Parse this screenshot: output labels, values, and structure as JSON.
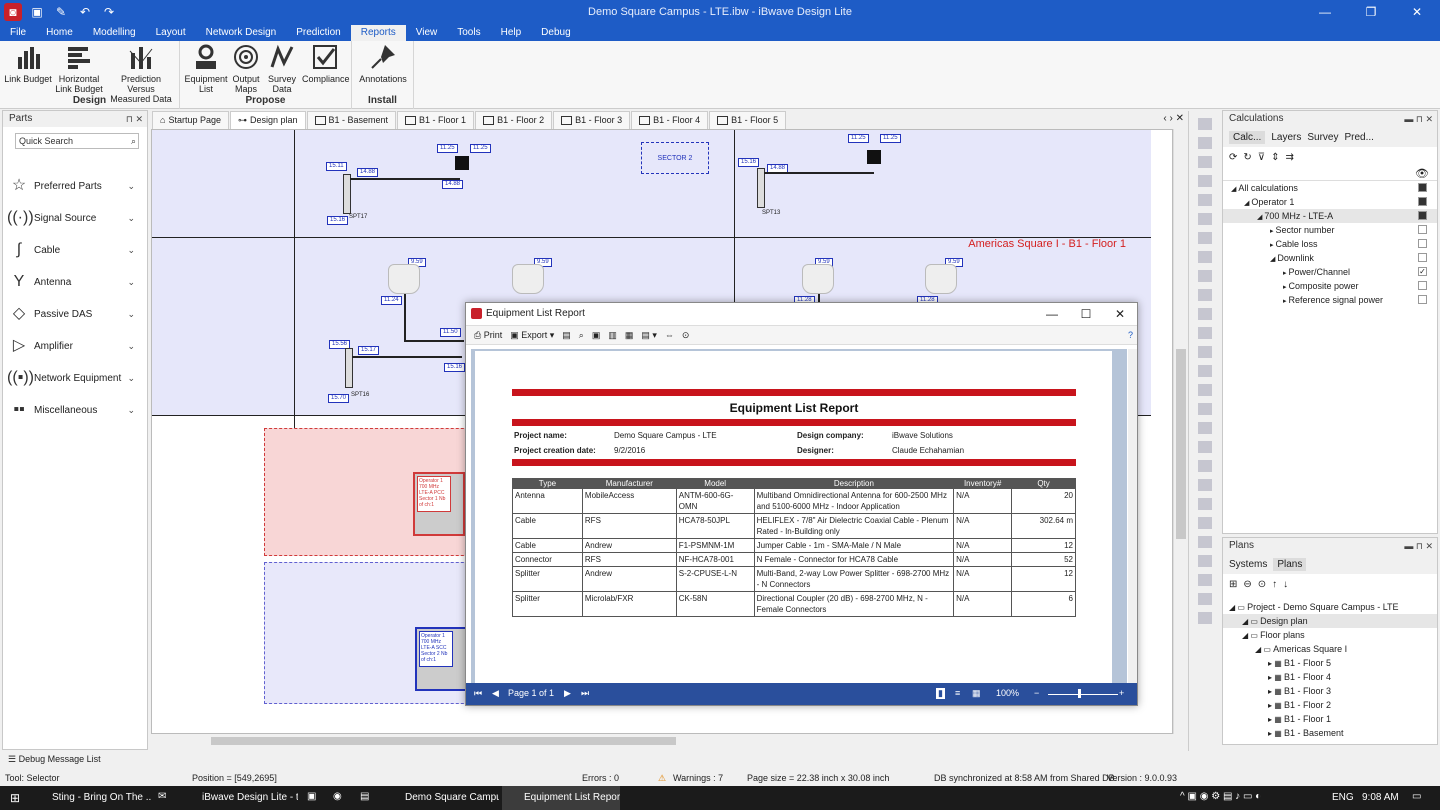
{
  "app": {
    "title": "Demo Square Campus - LTE.ibw - iBwave Design Lite"
  },
  "menu": [
    "File",
    "Home",
    "Modelling",
    "Layout",
    "Network Design",
    "Prediction",
    "Reports",
    "View",
    "Tools",
    "Help",
    "Debug"
  ],
  "ribbon": {
    "design": {
      "label": "Design",
      "buttons": [
        "Link Budget",
        "Horizontal Link Budget",
        "Prediction Versus Measured Data"
      ]
    },
    "propose": {
      "label": "Propose",
      "buttons": [
        "Equipment List",
        "Output Maps",
        "Survey Data",
        "Compliance"
      ]
    },
    "install": {
      "label": "Install",
      "buttons": [
        "Annotations"
      ]
    }
  },
  "parts": {
    "title": "Parts",
    "search_placeholder": "Quick Search",
    "items": [
      "Preferred Parts",
      "Signal Source",
      "Cable",
      "Antenna",
      "Passive DAS",
      "Amplifier",
      "Network Equipment",
      "Miscellaneous"
    ]
  },
  "tabs": [
    "Startup Page",
    "Design plan",
    "B1 - Basement",
    "B1 - Floor 1",
    "B1 - Floor 2",
    "B1 - Floor 3",
    "B1 - Floor 4",
    "B1 - Floor 5"
  ],
  "canvas": {
    "floor_label": "Americas Square I - B1 - Floor 1",
    "sector_label": "SECTOR 2",
    "labels": [
      "15.11",
      "14.88",
      "11.25",
      "11.25",
      "14.88",
      "SPT17",
      "SPT13",
      "15.16",
      "15.16",
      "11.25",
      "11.25",
      "14.88",
      "9.59",
      "9.59",
      "9.59",
      "9.59",
      "11.24",
      "11.24",
      "11.28",
      "11.28",
      "15.56",
      "15.17",
      "11.50",
      "15.16",
      "15.70",
      "SPT16"
    ],
    "red_box": "Operator 1 700 MHz LTE-A PCC Sector 1 Nb of ch:1",
    "blue_box": "Operator 1 700 MHz LTE-A SCC Sector 2 Nb of ch:1"
  },
  "calc": {
    "title": "Calculations",
    "tabs": [
      "Calc...",
      "Layers",
      "Survey",
      "Pred..."
    ],
    "tree": [
      {
        "label": "All calculations",
        "level": 0,
        "state": "on"
      },
      {
        "label": "Operator 1",
        "level": 1,
        "state": "on"
      },
      {
        "label": "700 MHz - LTE-A",
        "level": 2,
        "state": "on",
        "sel": true
      },
      {
        "label": "Sector number",
        "level": 3,
        "state": "off"
      },
      {
        "label": "Cable loss",
        "level": 3,
        "state": "off"
      },
      {
        "label": "Downlink",
        "level": 3,
        "state": "off"
      },
      {
        "label": "Power/Channel",
        "level": 4,
        "state": "chk"
      },
      {
        "label": "Composite power",
        "level": 4,
        "state": "off"
      },
      {
        "label": "Reference signal power",
        "level": 4,
        "state": "off"
      }
    ]
  },
  "plans": {
    "title": "Plans",
    "tabs": [
      "Systems",
      "Plans"
    ],
    "tree": [
      {
        "label": "Project - Demo Square Campus - LTE",
        "level": 0
      },
      {
        "label": "Design plan",
        "level": 1,
        "sel": true
      },
      {
        "label": "Floor plans",
        "level": 1
      },
      {
        "label": "Americas Square I",
        "level": 2
      },
      {
        "label": "B1 - Floor 5",
        "level": 3
      },
      {
        "label": "B1 - Floor 4",
        "level": 3
      },
      {
        "label": "B1 - Floor 3",
        "level": 3
      },
      {
        "label": "B1 - Floor 2",
        "level": 3
      },
      {
        "label": "B1 - Floor 1",
        "level": 3
      },
      {
        "label": "B1 - Basement",
        "level": 3
      }
    ]
  },
  "debug": {
    "label": "Debug Message List"
  },
  "status": {
    "tool": "Tool: Selector",
    "position": "Position = [549,2695]",
    "errors": "Errors : 0",
    "warnings": "Warnings : 7",
    "page_size": "Page size = 22.38 inch x 30.08 inch",
    "db": "DB synchronized at 8:58 AM from Shared DB.",
    "version": "Version : 9.0.0.93"
  },
  "dialog": {
    "title": "Equipment List Report",
    "print": "Print",
    "export": "Export",
    "report_title": "Equipment List Report",
    "project_name_label": "Project name:",
    "project_name": "Demo Square Campus - LTE",
    "creation_date_label": "Project creation date:",
    "creation_date": "9/2/2016",
    "company_label": "Design company:",
    "company": "iBwave Solutions",
    "designer_label": "Designer:",
    "designer": "Claude Echahamian",
    "columns": [
      "Type",
      "Manufacturer",
      "Model",
      "Description",
      "Inventory#",
      "Qty"
    ],
    "rows": [
      [
        "Antenna",
        "MobileAccess",
        "ANTM-600-6G-OMN",
        "Multiband Omnidirectional Antenna for 600-2500 MHz and 5100-6000 MHz - Indoor Application",
        "N/A",
        "20"
      ],
      [
        "Cable",
        "RFS",
        "HCA78-50JPL",
        "HELIFLEX - 7/8\" Air Dielectric Coaxial Cable - Plenum Rated - In-Building only",
        "N/A",
        "302.64 m"
      ],
      [
        "Cable",
        "Andrew",
        "F1-PSMNM-1M",
        "Jumper Cable - 1m - SMA-Male / N Male",
        "N/A",
        "12"
      ],
      [
        "Connector",
        "RFS",
        "NF-HCA78-001",
        "N Female - Connector for HCA78 Cable",
        "N/A",
        "52"
      ],
      [
        "Splitter",
        "Andrew",
        "S-2-CPUSE-L-N",
        "Multi-Band, 2-way Low Power Splitter - 698-2700 MHz - N Connectors",
        "N/A",
        "12"
      ],
      [
        "Splitter",
        "Microlab/FXR",
        "CK-58N",
        "Directional Coupler (20 dB) - 698-2700 MHz, N -Female Connectors",
        "N/A",
        "6"
      ]
    ],
    "page": "Page 1 of 1",
    "zoom": "100%"
  },
  "taskbar": {
    "items": [
      "Sting - Bring On The ...",
      "iBwave Design Lite - t...",
      "Demo Square Campu...",
      "Equipment List Report"
    ],
    "lang": "ENG",
    "time": "9:08 AM"
  },
  "colors": {
    "accent": "#1e5cc6",
    "report_red": "#c8141c"
  }
}
